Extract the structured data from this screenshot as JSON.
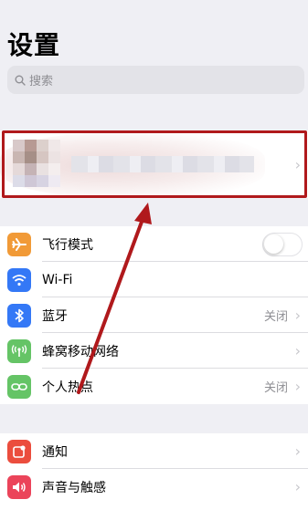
{
  "page": {
    "title": "设置"
  },
  "search": {
    "placeholder": "搜索"
  },
  "network": {
    "items": [
      {
        "label": "飞行模式",
        "icon": "airplane-icon",
        "color": "#f19a37"
      },
      {
        "label": "Wi-Fi",
        "icon": "wifi-icon",
        "color": "#3478f6"
      },
      {
        "label": "蓝牙",
        "icon": "bluetooth-icon",
        "color": "#3478f6",
        "value": "关闭"
      },
      {
        "label": "蜂窝移动网络",
        "icon": "antenna-icon",
        "color": "#65c466"
      },
      {
        "label": "个人热点",
        "icon": "hotspot-icon",
        "color": "#65c466",
        "value": "关闭"
      }
    ]
  },
  "more": {
    "items": [
      {
        "label": "通知",
        "icon": "notifications-icon",
        "color": "#eb4d3d"
      },
      {
        "label": "声音与触感",
        "icon": "speaker-icon",
        "color": "#eb445a"
      }
    ]
  },
  "annotation": {
    "color": "#b0191c"
  }
}
